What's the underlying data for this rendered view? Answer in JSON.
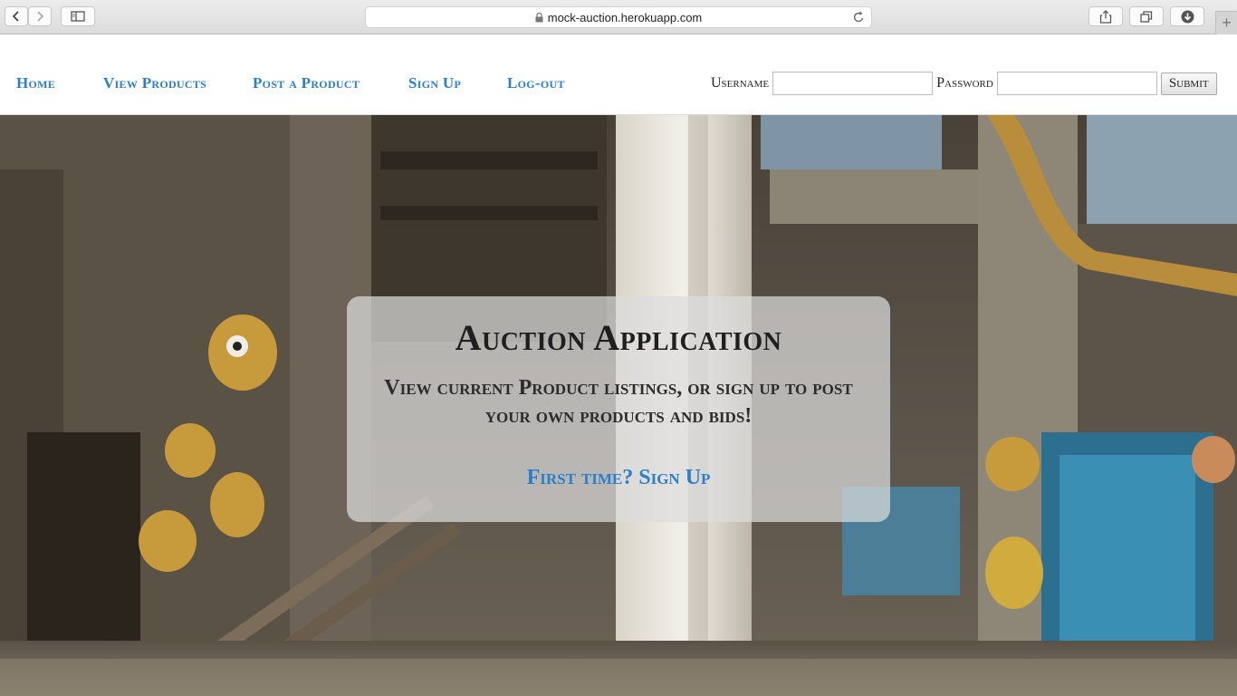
{
  "browser": {
    "url": "mock-auction.herokuapp.com",
    "icons": [
      "back-icon",
      "forward-icon",
      "sidebar-icon",
      "lock-icon",
      "reload-icon",
      "share-icon",
      "tabs-icon",
      "download-icon",
      "plus-icon"
    ]
  },
  "nav": {
    "links": [
      "Home",
      "View Products",
      "Post a Product",
      "Sign Up",
      "Log-out"
    ],
    "username_label": "Username",
    "password_label": "Password",
    "username_value": "",
    "password_value": "",
    "submit_label": "Submit",
    "link_color": "#2a7fc9"
  },
  "hero": {
    "title": "Auction Application",
    "subtitle": "View current Product listings, or sign up to post your own products and bids!",
    "cta": "First time? Sign Up"
  }
}
